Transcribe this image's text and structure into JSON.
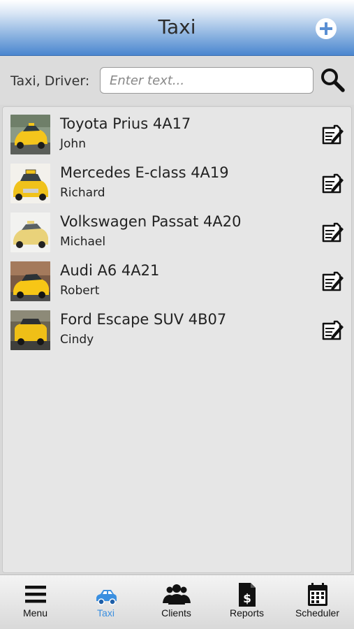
{
  "header": {
    "title": "Taxi"
  },
  "search": {
    "label": "Taxi, Driver:",
    "value": "",
    "placeholder": "Enter text..."
  },
  "taxis": [
    {
      "title": "Toyota Prius 4A17",
      "driver": "John"
    },
    {
      "title": "Mercedes E-class 4A19",
      "driver": "Richard"
    },
    {
      "title": "Volkswagen Passat 4A20",
      "driver": "Michael"
    },
    {
      "title": "Audi A6 4A21",
      "driver": "Robert"
    },
    {
      "title": "Ford Escape SUV 4B07",
      "driver": "Cindy"
    }
  ],
  "tabs": [
    {
      "label": "Menu",
      "icon": "menu-icon",
      "active": false
    },
    {
      "label": "Taxi",
      "icon": "taxi-car-icon",
      "active": true
    },
    {
      "label": "Clients",
      "icon": "clients-icon",
      "active": false
    },
    {
      "label": "Reports",
      "icon": "reports-icon",
      "active": false
    },
    {
      "label": "Scheduler",
      "icon": "scheduler-icon",
      "active": false
    }
  ],
  "colors": {
    "header_top": "#ffffff",
    "header_bottom": "#4a86cf",
    "active_tab": "#3a8fe0",
    "taxi_yellow": "#f2c21a"
  }
}
